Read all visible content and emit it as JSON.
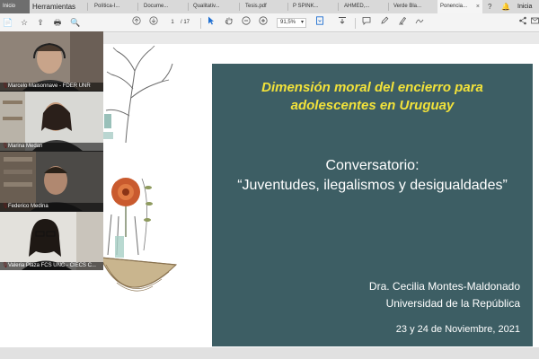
{
  "tabs": [
    {
      "label": "Inicio"
    },
    {
      "label": "Herramientas"
    },
    {
      "label": "Política-I..."
    },
    {
      "label": "Docume..."
    },
    {
      "label": "Qualitativ..."
    },
    {
      "label": "Tesis.pdf"
    },
    {
      "label": "P SPINK..."
    },
    {
      "label": "AHMED,..."
    },
    {
      "label": "Verde Bla..."
    },
    {
      "label": "Ponencia...",
      "close": "×"
    }
  ],
  "tab_right": {
    "help": "?",
    "bell": "🔔",
    "signin": "Inicia"
  },
  "toolbar": {
    "icons": [
      "📄",
      "☆",
      "⇪",
      "🖶",
      "🔍"
    ],
    "page_current": "1",
    "page_total": "/ 17",
    "zoom": "91,5%",
    "zoom_caret": "▾"
  },
  "slide": {
    "title_line1": "Dimensión moral del encierro para",
    "title_line2": "adolescentes en Uruguay",
    "conv_line1": "Conversatorio:",
    "conv_line2": "“Juventudes, ilegalismos y desigualdades”",
    "author": "Dra. Cecilia Montes-Maldonado",
    "university": "Universidad de la República",
    "date": "23 y 24 de Noviembre, 2021"
  },
  "participants": [
    {
      "name": "Marcelo Maisonnave - FDER UNR"
    },
    {
      "name": "Marina Medan"
    },
    {
      "name": "Federico Medina"
    },
    {
      "name": "Valeria Plaza FCS UNC - CIECS C..."
    }
  ],
  "colors": {
    "slide_bg": "#3d5e64",
    "title": "#f2e23a",
    "accent": "#1f6fd1"
  }
}
